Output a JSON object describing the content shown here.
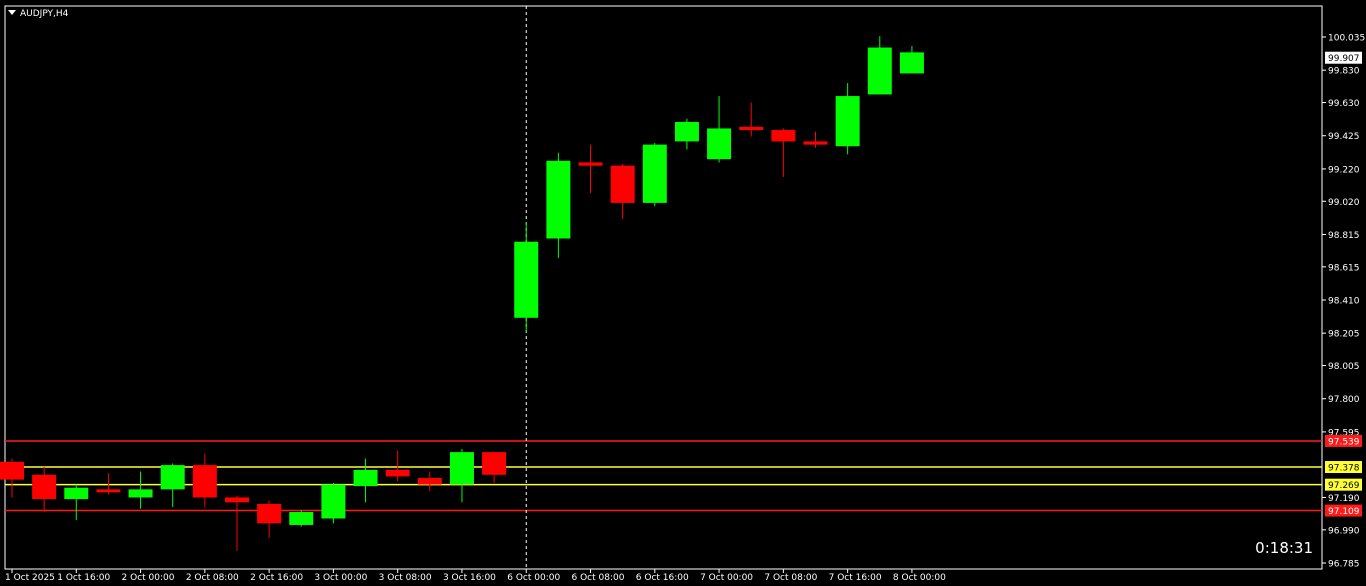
{
  "symbol": "AUDJPY,H4",
  "countdown": "0:18:31",
  "colors": {
    "background": "#000000",
    "frame": "#ffffff",
    "bull": "#00ff00",
    "bear": "#ff0000",
    "red_level": "#ff1a1a",
    "yellow_level": "#ffff33"
  },
  "chart_data": {
    "type": "candlestick",
    "timeframe": "H4",
    "ylim": [
      96.785,
      100.14
    ],
    "y_ticks": [
      "100.035",
      "99.830",
      "99.630",
      "99.425",
      "99.220",
      "99.020",
      "98.815",
      "98.615",
      "98.410",
      "98.205",
      "98.005",
      "97.800",
      "97.595",
      "97.190",
      "96.990",
      "96.785"
    ],
    "x_ticks": [
      "1 Oct 2025",
      "1 Oct 16:00",
      "2 Oct 00:00",
      "2 Oct 08:00",
      "2 Oct 16:00",
      "3 Oct 00:00",
      "3 Oct 08:00",
      "3 Oct 16:00",
      "6 Oct 00:00",
      "6 Oct 08:00",
      "6 Oct 16:00",
      "7 Oct 00:00",
      "7 Oct 08:00",
      "7 Oct 16:00",
      "8 Oct 00:00"
    ],
    "current_price": "99.907",
    "vertical_marker_at": "6 Oct 00:00",
    "levels": [
      {
        "label": "97.539",
        "value": 97.539,
        "color": "red"
      },
      {
        "label": "97.378",
        "value": 97.378,
        "color": "yellow"
      },
      {
        "label": "97.269",
        "value": 97.269,
        "color": "yellow"
      },
      {
        "label": "97.109",
        "value": 97.109,
        "color": "red"
      }
    ],
    "candles": [
      {
        "o": 97.41,
        "h": 97.43,
        "l": 97.19,
        "c": 97.3
      },
      {
        "o": 97.33,
        "h": 97.38,
        "l": 97.1,
        "c": 97.18
      },
      {
        "o": 97.18,
        "h": 97.27,
        "l": 97.05,
        "c": 97.25
      },
      {
        "o": 97.24,
        "h": 97.34,
        "l": 97.21,
        "c": 97.23
      },
      {
        "o": 97.19,
        "h": 97.35,
        "l": 97.12,
        "c": 97.24
      },
      {
        "o": 97.24,
        "h": 97.4,
        "l": 97.13,
        "c": 97.39
      },
      {
        "o": 97.39,
        "h": 97.46,
        "l": 97.13,
        "c": 97.19
      },
      {
        "o": 97.19,
        "h": 97.2,
        "l": 96.86,
        "c": 97.16
      },
      {
        "o": 97.15,
        "h": 97.17,
        "l": 96.94,
        "c": 97.03
      },
      {
        "o": 97.02,
        "h": 97.11,
        "l": 97.01,
        "c": 97.1
      },
      {
        "o": 97.06,
        "h": 97.28,
        "l": 97.03,
        "c": 97.27
      },
      {
        "o": 97.26,
        "h": 97.43,
        "l": 97.16,
        "c": 97.36
      },
      {
        "o": 97.36,
        "h": 97.48,
        "l": 97.29,
        "c": 97.32
      },
      {
        "o": 97.31,
        "h": 97.35,
        "l": 97.23,
        "c": 97.27
      },
      {
        "o": 97.27,
        "h": 97.49,
        "l": 97.16,
        "c": 97.47
      },
      {
        "o": 97.47,
        "h": 97.47,
        "l": 97.28,
        "c": 97.33
      },
      {
        "o": 98.3,
        "h": 98.89,
        "l": 98.21,
        "c": 98.77
      },
      {
        "o": 98.79,
        "h": 99.32,
        "l": 98.67,
        "c": 99.27
      },
      {
        "o": 99.26,
        "h": 99.37,
        "l": 99.07,
        "c": 99.24
      },
      {
        "o": 99.24,
        "h": 99.25,
        "l": 98.91,
        "c": 99.01
      },
      {
        "o": 99.01,
        "h": 99.38,
        "l": 98.99,
        "c": 99.37
      },
      {
        "o": 99.39,
        "h": 99.53,
        "l": 99.34,
        "c": 99.51
      },
      {
        "o": 99.28,
        "h": 99.67,
        "l": 99.26,
        "c": 99.47
      },
      {
        "o": 99.48,
        "h": 99.63,
        "l": 99.42,
        "c": 99.46
      },
      {
        "o": 99.46,
        "h": 99.47,
        "l": 99.17,
        "c": 99.39
      },
      {
        "o": 99.39,
        "h": 99.45,
        "l": 99.35,
        "c": 99.37
      },
      {
        "o": 99.36,
        "h": 99.75,
        "l": 99.31,
        "c": 99.67
      },
      {
        "o": 99.68,
        "h": 100.04,
        "l": 99.68,
        "c": 99.97
      },
      {
        "o": 99.81,
        "h": 99.98,
        "l": 99.81,
        "c": 99.94
      }
    ]
  }
}
